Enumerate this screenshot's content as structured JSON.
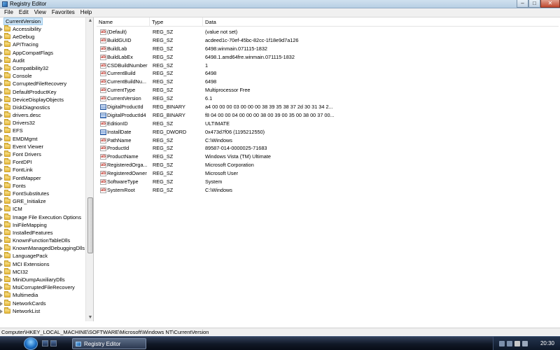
{
  "window": {
    "title": "Registry Editor"
  },
  "menu": [
    "File",
    "Edit",
    "View",
    "Favorites",
    "Help"
  ],
  "tree": {
    "selected": "CurrentVersion",
    "items": [
      "Accessibility",
      "AeDebug",
      "APITracing",
      "AppCompatFlags",
      "Audit",
      "Compatibility32",
      "Console",
      "CorruptedFileRecovery",
      "DefaultProductKey",
      "DeviceDisplayObjects",
      "DiskDiagnostics",
      "drivers.desc",
      "Drivers32",
      "EFS",
      "EMDMgmt",
      "Event Viewer",
      "Font Drivers",
      "FontDPI",
      "FontLink",
      "FontMapper",
      "Fonts",
      "FontSubstitutes",
      "GRE_Initialize",
      "ICM",
      "Image File Execution Options",
      "IniFileMapping",
      "InstalledFeatures",
      "KnownFunctionTableDlls",
      "KnownManagedDebuggingDlls",
      "LanguagePack",
      "MCI Extensions",
      "MCI32",
      "MiniDumpAuxiliaryDlls",
      "MsiCorruptedFileRecovery",
      "Multimedia",
      "NetworkCards",
      "NetworkList"
    ]
  },
  "columns": {
    "name": "Name",
    "type": "Type",
    "data": "Data"
  },
  "rows": [
    {
      "icon": "string-value-icon",
      "name": "(Default)",
      "type": "REG_SZ",
      "data": "(value not set)"
    },
    {
      "icon": "string-value-icon",
      "name": "BuildGUID",
      "type": "REG_SZ",
      "data": "acdeed1c-70ef-45bc-82cc-1f18e9d7a126"
    },
    {
      "icon": "string-value-icon",
      "name": "BuildLab",
      "type": "REG_SZ",
      "data": "6498.winmain.071115-1832"
    },
    {
      "icon": "string-value-icon",
      "name": "BuildLabEx",
      "type": "REG_SZ",
      "data": "6498.1.amd64fre.winmain.071115-1832"
    },
    {
      "icon": "string-value-icon",
      "name": "CSDBuildNumber",
      "type": "REG_SZ",
      "data": "1"
    },
    {
      "icon": "string-value-icon",
      "name": "CurrentBuild",
      "type": "REG_SZ",
      "data": "6498"
    },
    {
      "icon": "string-value-icon",
      "name": "CurrentBuildNu...",
      "type": "REG_SZ",
      "data": "6498"
    },
    {
      "icon": "string-value-icon",
      "name": "CurrentType",
      "type": "REG_SZ",
      "data": "Multiprocessor Free"
    },
    {
      "icon": "string-value-icon",
      "name": "CurrentVersion",
      "type": "REG_SZ",
      "data": "6.1"
    },
    {
      "icon": "binary-value-icon",
      "name": "DigitalProductId",
      "type": "REG_BINARY",
      "data": "a4 00 00 00 03 00 00 00 38 39 35 38 37 2d 30 31 34 2..."
    },
    {
      "icon": "binary-value-icon",
      "name": "DigitalProductId4",
      "type": "REG_BINARY",
      "data": "f8 04 00 00 04 00 00 00 38 00 39 00 35 00 38 00 37 00..."
    },
    {
      "icon": "string-value-icon",
      "name": "EditionID",
      "type": "REG_SZ",
      "data": "ULTIMATE"
    },
    {
      "icon": "binary-value-icon",
      "name": "InstallDate",
      "type": "REG_DWORD",
      "data": "0x473d7f06 (1195212550)"
    },
    {
      "icon": "string-value-icon",
      "name": "PathName",
      "type": "REG_SZ",
      "data": "C:\\Windows"
    },
    {
      "icon": "string-value-icon",
      "name": "ProductId",
      "type": "REG_SZ",
      "data": "89587-014-0000025-71683"
    },
    {
      "icon": "string-value-icon",
      "name": "ProductName",
      "type": "REG_SZ",
      "data": "Windows Vista (TM) Ultimate"
    },
    {
      "icon": "string-value-icon",
      "name": "RegisteredOrga...",
      "type": "REG_SZ",
      "data": "Microsoft Corporation"
    },
    {
      "icon": "string-value-icon",
      "name": "RegisteredOwner",
      "type": "REG_SZ",
      "data": "Microsoft User"
    },
    {
      "icon": "string-value-icon",
      "name": "SoftwareType",
      "type": "REG_SZ",
      "data": "System"
    },
    {
      "icon": "string-value-icon",
      "name": "SystemRoot",
      "type": "REG_SZ",
      "data": "C:\\Windows"
    }
  ],
  "status": "Computer\\HKEY_LOCAL_MACHINE\\SOFTWARE\\Microsoft\\Windows NT\\CurrentVersion",
  "taskbar": {
    "task": "Registry Editor",
    "clock": "20:30"
  }
}
